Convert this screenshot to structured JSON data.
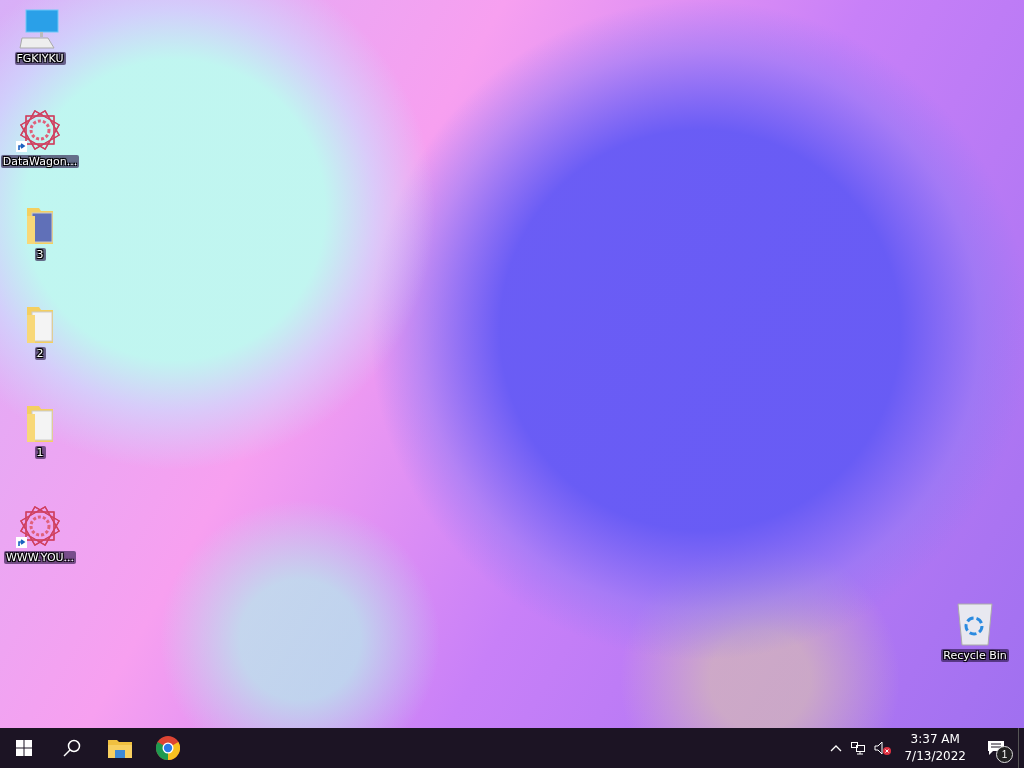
{
  "desktop_icons": [
    {
      "kind": "computer",
      "label": "FGKIYKU",
      "shortcut": false
    },
    {
      "kind": "star",
      "label": "DataWagon...",
      "shortcut": true
    },
    {
      "kind": "folder",
      "label": "3",
      "shortcut": false
    },
    {
      "kind": "folder",
      "label": "2",
      "shortcut": false
    },
    {
      "kind": "folder",
      "label": "1",
      "shortcut": false
    },
    {
      "kind": "star",
      "label": "WWW.YOU...",
      "shortcut": true
    }
  ],
  "recycle_bin": {
    "label": "Recycle Bin"
  },
  "taskbar": {
    "apps": [
      {
        "kind": "start"
      },
      {
        "kind": "search"
      },
      {
        "kind": "explorer"
      },
      {
        "kind": "chrome"
      }
    ],
    "tray": {
      "time": "3:37 AM",
      "date": "7/13/2022",
      "volume_muted": true,
      "notification_count": "1"
    }
  }
}
